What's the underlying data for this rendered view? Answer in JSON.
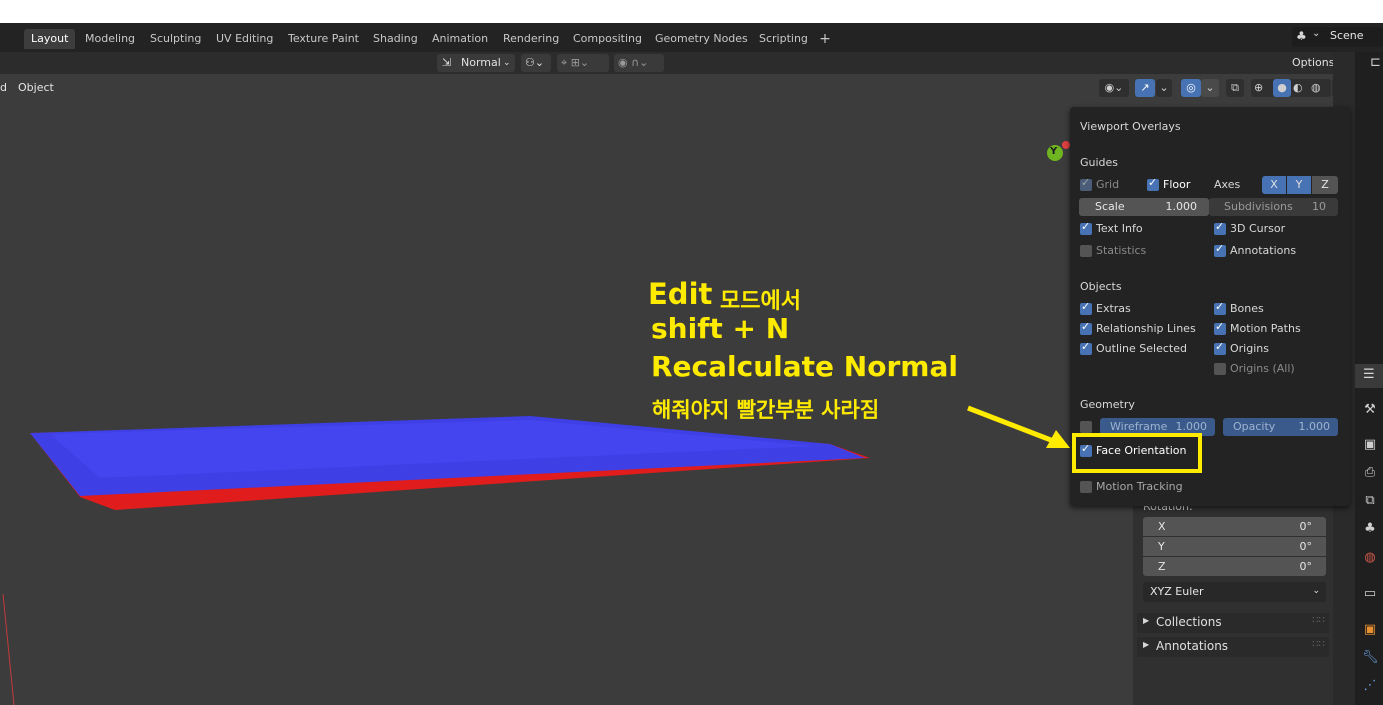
{
  "tabs": [
    "Layout",
    "Modeling",
    "Sculpting",
    "UV Editing",
    "Texture Paint",
    "Shading",
    "Animation",
    "Rendering",
    "Compositing",
    "Geometry Nodes",
    "Scripting"
  ],
  "active_tab": "Layout",
  "scene": "Scene",
  "header": {
    "orientation": "Normal",
    "options": "Options"
  },
  "viewport": {
    "object_menu": "Object",
    "left_fragment": "d",
    "gizmo_axis": "Y"
  },
  "overlays": {
    "title": "Viewport Overlays",
    "guides_label": "Guides",
    "grid": "Grid",
    "floor": "Floor",
    "axes": "Axes",
    "axis_x": "X",
    "axis_y": "Y",
    "axis_z": "Z",
    "scale_label": "Scale",
    "scale_value": "1.000",
    "subdivisions_label": "Subdivisions",
    "subdivisions_value": "10",
    "text_info": "Text Info",
    "cursor_3d": "3D Cursor",
    "statistics": "Statistics",
    "annotations": "Annotations",
    "objects_label": "Objects",
    "extras": "Extras",
    "bones": "Bones",
    "relationship_lines": "Relationship Lines",
    "motion_paths": "Motion Paths",
    "outline_selected": "Outline Selected",
    "origins": "Origins",
    "origins_all": "Origins (All)",
    "geometry_label": "Geometry",
    "wireframe_label": "Wireframe",
    "wireframe_value": "1.000",
    "opacity_label": "Opacity",
    "opacity_value": "1.000",
    "face_orientation": "Face Orientation",
    "motion_tracking": "Motion Tracking"
  },
  "sidebar": {
    "rotation_label": "Rotation:",
    "rot_x_label": "X",
    "rot_x": "0°",
    "rot_y_label": "Y",
    "rot_y": "0°",
    "rot_z_label": "Z",
    "rot_z": "0°",
    "rotation_mode": "XYZ Euler",
    "collections": "Collections",
    "annotations": "Annotations"
  },
  "annotation": {
    "line1_en": "Edit",
    "line1_ko": "모드에서",
    "line2": "shift + N",
    "line3": "Recalculate Normal",
    "line4": "해줘야지 빨간부분 사라짐"
  },
  "colors": {
    "accent": "#4772b3",
    "highlight": "#ffeb00",
    "face_front": "#3f3fe6",
    "face_back": "#e01c1c"
  }
}
